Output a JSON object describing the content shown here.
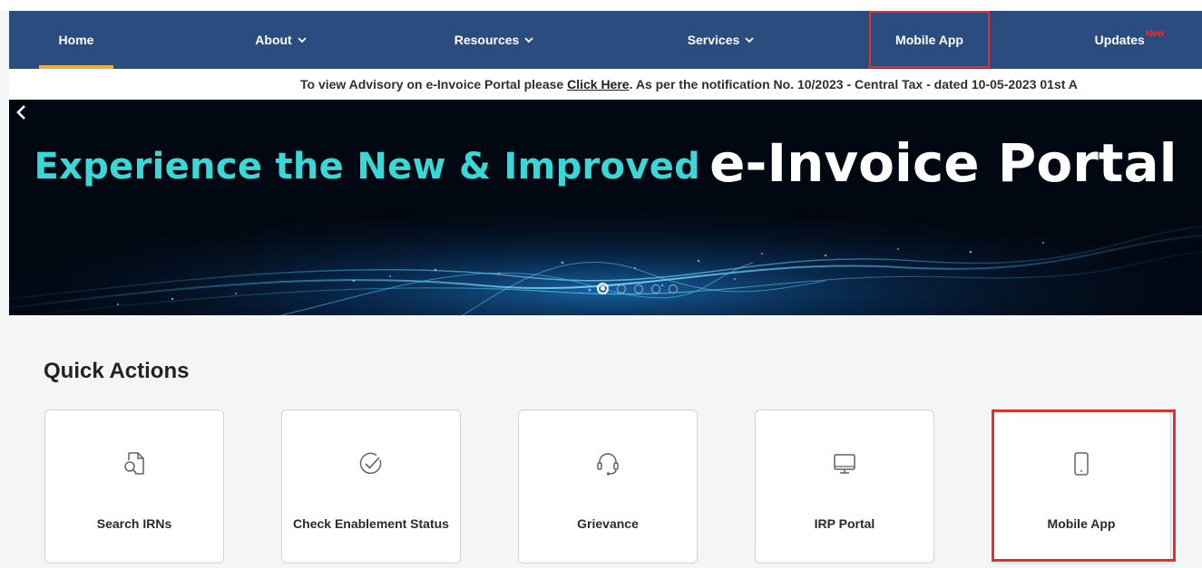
{
  "nav": {
    "items": [
      {
        "label": "Home",
        "dropdown": false
      },
      {
        "label": "About",
        "dropdown": true
      },
      {
        "label": "Resources",
        "dropdown": true
      },
      {
        "label": "Services",
        "dropdown": true
      },
      {
        "label": "Mobile App",
        "dropdown": false
      },
      {
        "label": "Updates",
        "dropdown": false,
        "badge": "New"
      }
    ],
    "active": "Home",
    "colors": {
      "bar": "#2b4c7e",
      "active_indicator": "#e8b03a",
      "highlight": "#e03030"
    }
  },
  "ticker": {
    "prefix": "To view Advisory on e-Invoice Portal please ",
    "link": "Click Here",
    "suffix": ". As per the notification No. 10/2023 - Central Tax - dated 10-05-2023 01st A"
  },
  "banner": {
    "title_small": "Experience the New & Improved",
    "title_big": "e-Invoice Portal",
    "prev_icon": "chevron-left-icon",
    "slide_count": 5,
    "active_slide": 1
  },
  "quick_actions": {
    "title": "Quick Actions",
    "items": [
      {
        "label": "Search IRNs",
        "icon": "search-document-icon"
      },
      {
        "label": "Check Enablement Status",
        "icon": "check-circle-icon"
      },
      {
        "label": "Grievance",
        "icon": "headset-icon"
      },
      {
        "label": "IRP Portal",
        "icon": "monitor-icon"
      },
      {
        "label": "Mobile App",
        "icon": "mobile-phone-icon"
      }
    ]
  }
}
